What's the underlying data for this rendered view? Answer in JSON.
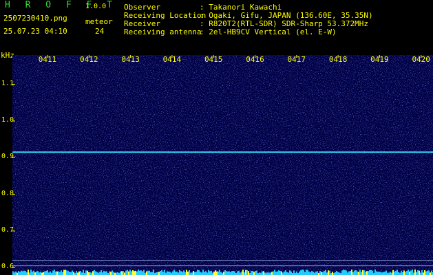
{
  "header": {
    "app_title": "H R O F F T",
    "app_version": "1.0.0",
    "filename": "2507230410.png",
    "meteor_label": "meteor",
    "datetime": "25.07.23 04:10",
    "meteor_count": "24"
  },
  "station_info": [
    {
      "label": "Observer",
      "value": ": Takanori Kawachi"
    },
    {
      "label": "Receiving Location",
      "value": ": Ogaki, Gifu, JAPAN (136.60E, 35.35N)"
    },
    {
      "label": "Receiver",
      "value": ": R820T2(RTL-SDR) SDR-Sharp 53.372MHz"
    },
    {
      "label": "Receiving antenna",
      "value": ": 2el-HB9CV Vertical (el. E-W)"
    }
  ],
  "axis": {
    "unit": "kHz",
    "y_ticks": [
      "1.1",
      "1.0",
      "0.9",
      "0.8",
      "0.7",
      "0.6"
    ],
    "x_ticks": [
      "0411",
      "0412",
      "0413",
      "0414",
      "0415",
      "0416",
      "0417",
      "0418",
      "0419",
      "0420"
    ]
  },
  "colors": {
    "background": "#000000",
    "spectrogram_bg": "#000044",
    "text": "#ffff00",
    "title": "#33dd33",
    "carrier": "#33ddff"
  },
  "chart_data": {
    "type": "heatmap",
    "ylabel": "kHz",
    "ylim": [
      0.58,
      1.18
    ],
    "x_categories": [
      "0411",
      "0412",
      "0413",
      "0414",
      "0415",
      "0416",
      "0417",
      "0418",
      "0419",
      "0420"
    ],
    "carrier_khz": 0.915,
    "reference_lines_khz": [
      0.62,
      0.605
    ]
  }
}
